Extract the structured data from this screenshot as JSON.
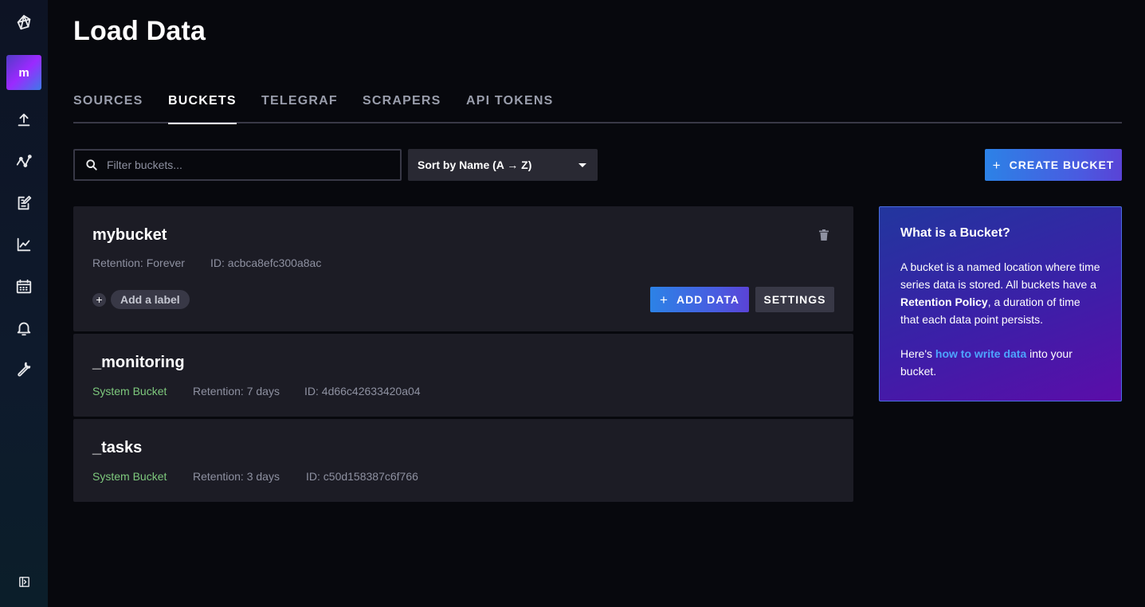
{
  "app": {
    "avatar_initial": "m"
  },
  "sidebar": {
    "items": [
      {
        "name": "influx-logo-icon"
      },
      {
        "name": "load-data-icon"
      },
      {
        "name": "data-explorer-icon"
      },
      {
        "name": "notebooks-icon"
      },
      {
        "name": "dashboards-icon"
      },
      {
        "name": "tasks-icon"
      },
      {
        "name": "alerts-icon"
      },
      {
        "name": "settings-icon"
      }
    ],
    "collapse_icon": "collapse-nav-icon"
  },
  "header": {
    "title": "Load Data"
  },
  "tabs": [
    {
      "label": "SOURCES",
      "active": false
    },
    {
      "label": "BUCKETS",
      "active": true
    },
    {
      "label": "TELEGRAF",
      "active": false
    },
    {
      "label": "SCRAPERS",
      "active": false
    },
    {
      "label": "API TOKENS",
      "active": false
    }
  ],
  "controls": {
    "filter_placeholder": "Filter buckets...",
    "filter_value": "",
    "sort_label": "Sort by Name (A → Z)",
    "create_label": "CREATE BUCKET"
  },
  "buckets": [
    {
      "name": "mybucket",
      "retention": "Retention: Forever",
      "id": "ID: acbca8efc300a8ac",
      "add_label": "Add a label",
      "add_data": "ADD DATA",
      "settings": "SETTINGS"
    },
    {
      "name": "_monitoring",
      "system": "System Bucket",
      "retention": "Retention: 7 days",
      "id": "ID: 4d66c42633420a04"
    },
    {
      "name": "_tasks",
      "system": "System Bucket",
      "retention": "Retention: 3 days",
      "id": "ID: c50d158387c6f766"
    }
  ],
  "info": {
    "title": "What is a Bucket?",
    "p1_a": "A bucket is a named location where time series data is stored. All buckets have a ",
    "p1_b": "Retention Policy",
    "p1_c": ", a duration of time that each data point persists.",
    "p2_a": "Here's ",
    "p2_link": "how to write data",
    "p2_c": " into your bucket."
  },
  "colors": {
    "accent": "#2c82e6",
    "system_bucket": "#7ec97d",
    "background": "#07080d",
    "card": "#1c1c25"
  }
}
